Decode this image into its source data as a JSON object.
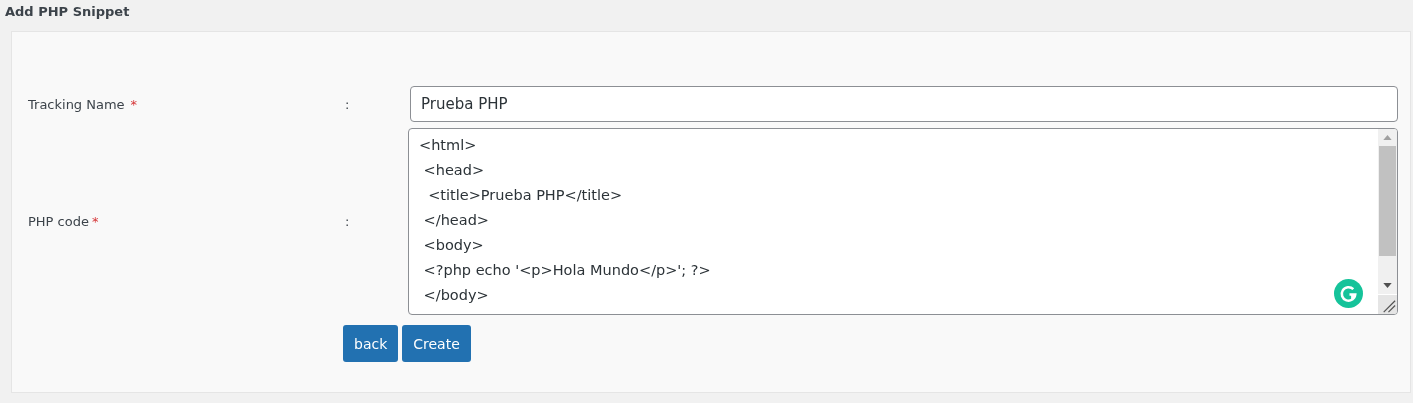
{
  "title": "Add PHP Snippet",
  "fields": [
    {
      "label": "Tracking Name",
      "required_mark": "*",
      "separator": ":",
      "kind": "input",
      "value": "Prueba PHP"
    },
    {
      "label": "PHP code",
      "required_mark": "*",
      "separator": ":",
      "kind": "code",
      "lines": [
        "<html>",
        " <head>",
        "  <title>Prueba PHP</title>",
        " </head>",
        " <body>",
        " <?php echo '<p>Hola Mundo</p>'; ?>",
        " </body>"
      ]
    }
  ],
  "buttons": [
    "back",
    "Create"
  ]
}
